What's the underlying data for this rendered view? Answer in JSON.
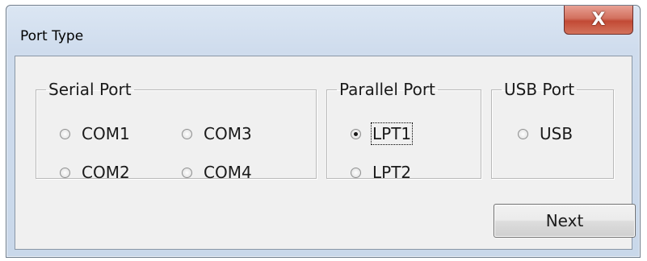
{
  "window": {
    "title": "Port Type",
    "close_glyph": "X"
  },
  "groups": {
    "serial": {
      "legend": "Serial Port",
      "options": [
        {
          "label": "COM1",
          "checked": false
        },
        {
          "label": "COM3",
          "checked": false
        },
        {
          "label": "COM2",
          "checked": false
        },
        {
          "label": "COM4",
          "checked": false
        }
      ]
    },
    "parallel": {
      "legend": "Parallel Port",
      "options": [
        {
          "label": "LPT1",
          "checked": true
        },
        {
          "label": "LPT2",
          "checked": false
        }
      ]
    },
    "usb": {
      "legend": "USB Port",
      "options": [
        {
          "label": "USB",
          "checked": false
        }
      ]
    }
  },
  "buttons": {
    "next_label": "Next"
  },
  "icons": {
    "close": "close-icon",
    "radio": "radio-icon"
  },
  "colors": {
    "close_button": "#c24a35",
    "client_bg": "#f0f0f0",
    "titlebar": "#cfdced"
  }
}
